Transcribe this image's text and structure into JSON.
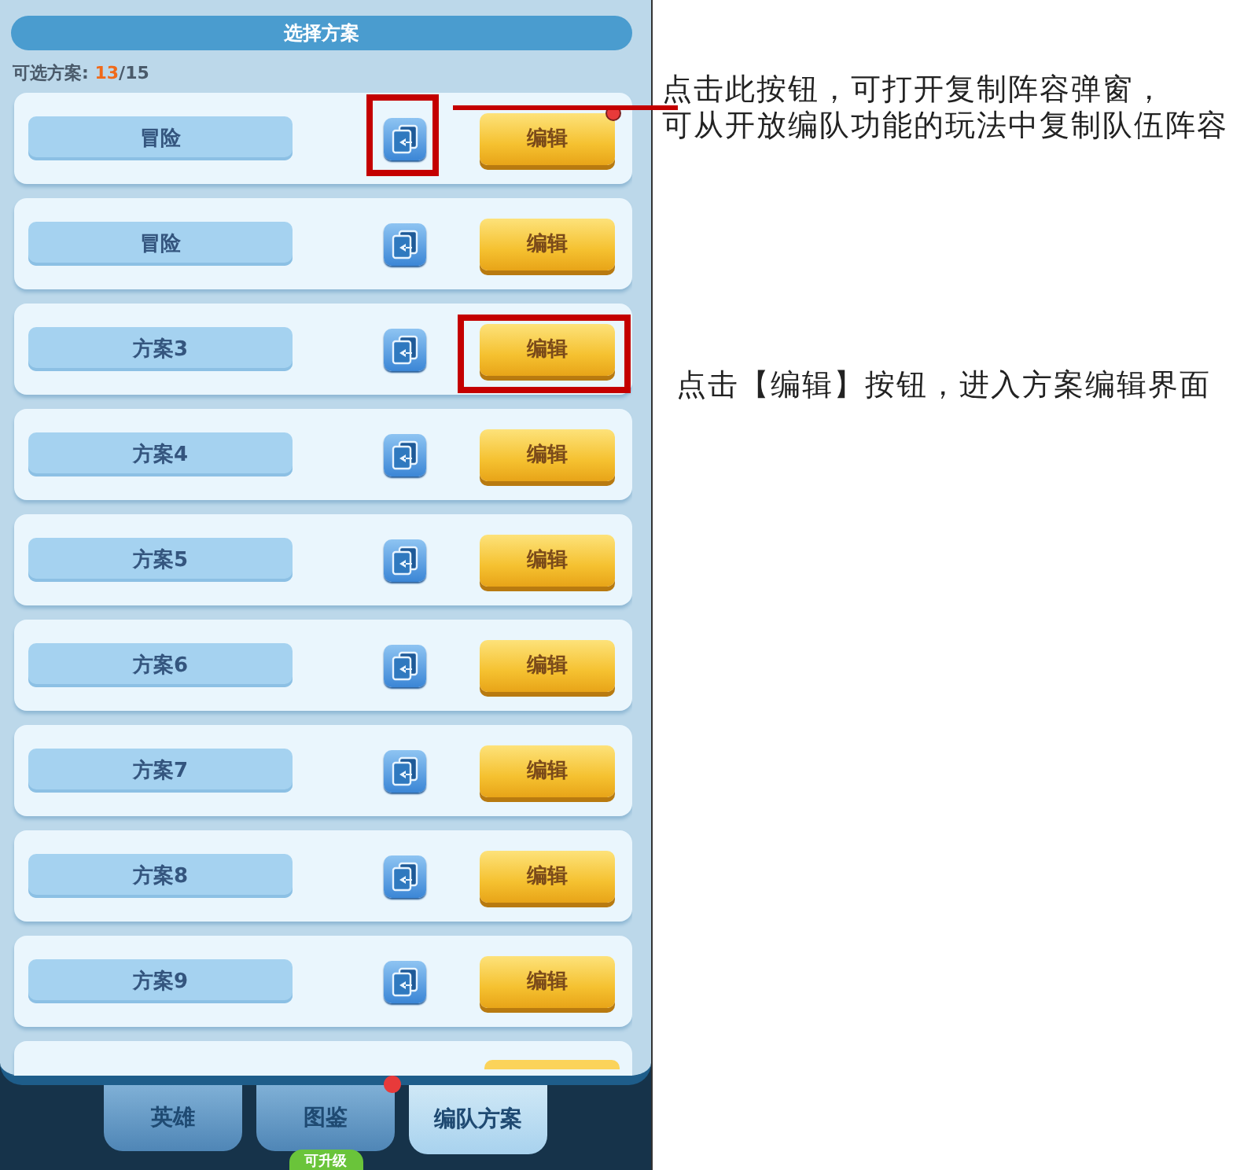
{
  "header": {
    "title": "选择方案"
  },
  "count": {
    "label": "可选方案: ",
    "current": "13",
    "total": "/15"
  },
  "plans": [
    {
      "name": "冒险",
      "edit_label": "编辑",
      "notify": true,
      "copy_highlighted": true,
      "edit_highlighted": false
    },
    {
      "name": "冒险",
      "edit_label": "编辑",
      "notify": false,
      "copy_highlighted": false,
      "edit_highlighted": false
    },
    {
      "name": "方案3",
      "edit_label": "编辑",
      "notify": false,
      "copy_highlighted": false,
      "edit_highlighted": true
    },
    {
      "name": "方案4",
      "edit_label": "编辑",
      "notify": false,
      "copy_highlighted": false,
      "edit_highlighted": false
    },
    {
      "name": "方案5",
      "edit_label": "编辑",
      "notify": false,
      "copy_highlighted": false,
      "edit_highlighted": false
    },
    {
      "name": "方案6",
      "edit_label": "编辑",
      "notify": false,
      "copy_highlighted": false,
      "edit_highlighted": false
    },
    {
      "name": "方案7",
      "edit_label": "编辑",
      "notify": false,
      "copy_highlighted": false,
      "edit_highlighted": false
    },
    {
      "name": "方案8",
      "edit_label": "编辑",
      "notify": false,
      "copy_highlighted": false,
      "edit_highlighted": false
    },
    {
      "name": "方案9",
      "edit_label": "编辑",
      "notify": false,
      "copy_highlighted": false,
      "edit_highlighted": false
    }
  ],
  "tabs": [
    {
      "label": "英雄",
      "selected": false,
      "notify": false
    },
    {
      "label": "图鉴",
      "selected": false,
      "notify": true,
      "badge": "可升级"
    },
    {
      "label": "编队方案",
      "selected": true,
      "notify": false
    }
  ],
  "annotations": [
    {
      "lines": [
        "点击此按钮，可打开复制阵容弹窗，",
        "可从开放编队功能的玩法中复制队伍阵容"
      ]
    },
    {
      "lines": [
        "点击【编辑】按钮，进入方案编辑界面"
      ]
    }
  ]
}
